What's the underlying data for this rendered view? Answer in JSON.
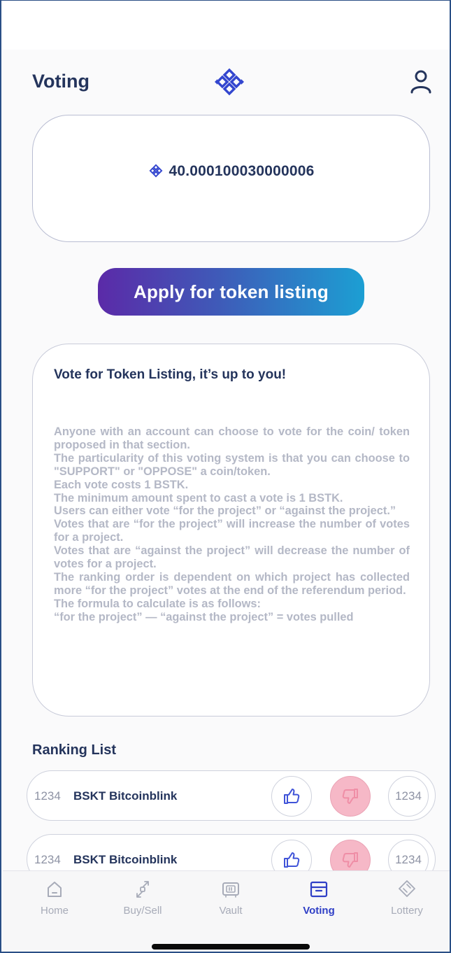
{
  "header": {
    "title": "Voting"
  },
  "balance": {
    "amount": "40.000100030000006"
  },
  "apply_button": {
    "label": "Apply for token listing"
  },
  "info_card": {
    "title": "Vote for Token Listing, it’s up to you!",
    "lines": [
      "Anyone with an account can choose to vote for the coin/ token proposed in that section.",
      "The particularity of this voting system is that you can choose to \"SUPPORT\" or \"OPPOSE\" a coin/token.",
      "Each vote costs 1 BSTK.",
      "The minimum amount spent to cast a vote is 1 BSTK.",
      "Users can either vote “for the project” or “against the project.”",
      "Votes that are “for the project” will increase the number of votes for a project.",
      "Votes that are “against the project” will decrease the number of votes for a project.",
      "The ranking order is dependent on which project has collected more “for the project” votes at the end of the referendum period.",
      "The formula to calculate is as follows:",
      "“for the project” — “against the project” = votes pulled"
    ]
  },
  "ranking": {
    "title": "Ranking List",
    "rows": [
      {
        "rank": "1234",
        "name": "BSKT Bitcoinblink",
        "votes": "1234"
      },
      {
        "rank": "1234",
        "name": "BSKT Bitcoinblink",
        "votes": "1234"
      }
    ]
  },
  "tabs": [
    {
      "label": "Home",
      "icon": "home-icon"
    },
    {
      "label": "Buy/Sell",
      "icon": "exchange-arrows-icon"
    },
    {
      "label": "Vault",
      "icon": "vault-icon"
    },
    {
      "label": "Voting",
      "icon": "ballot-box-icon"
    },
    {
      "label": "Lottery",
      "icon": "ticket-icon"
    }
  ],
  "active_tab": "Voting",
  "colors": {
    "brand_dark": "#24345c",
    "accent_blue": "#2f3fc6",
    "gradient_start": "#5b2aa8",
    "gradient_end": "#1c9fd3",
    "downvote_pink": "#f6b8c7",
    "muted_text": "#b4b8c6"
  }
}
